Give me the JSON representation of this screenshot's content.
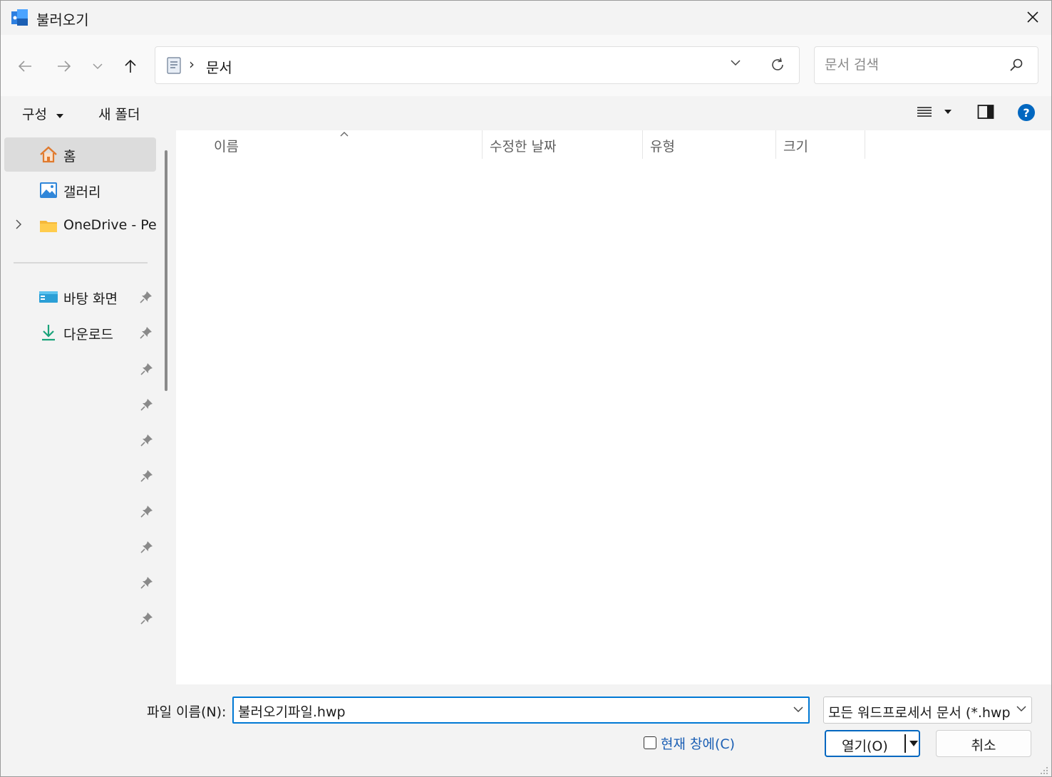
{
  "window": {
    "title": "불러오기"
  },
  "navbar": {
    "breadcrumb_sep": "›",
    "current_folder": "문서",
    "search_placeholder": "문서 검색"
  },
  "toolbar": {
    "organize_label": "구성",
    "new_folder_label": "새 폴더"
  },
  "sidebar": {
    "quick": [
      {
        "label": "홈",
        "icon": "home-icon",
        "selected": true
      },
      {
        "label": "갤러리",
        "icon": "gallery-icon",
        "selected": false
      },
      {
        "label": "OneDrive - Pers",
        "icon": "folder-icon",
        "selected": false
      }
    ],
    "pinned": [
      {
        "label": "바탕 화면",
        "icon": "desktop-icon"
      },
      {
        "label": "다운로드",
        "icon": "download-icon"
      }
    ],
    "pin_only_count": 8
  },
  "filelist": {
    "columns": [
      "이름",
      "수정한 날짜",
      "유형",
      "크기"
    ]
  },
  "bottom": {
    "filename_label": "파일 이름(N):",
    "filename_value": "불러오기파일.hwp",
    "filetype_value": "모든 워드프로세서 문서 (*.hwp",
    "current_window_label": "현재 창에(C)",
    "open_label": "열기(O)",
    "cancel_label": "취소"
  },
  "colors": {
    "accent": "#0078d4",
    "link": "#1b5fb4",
    "help": "#0067c0"
  }
}
